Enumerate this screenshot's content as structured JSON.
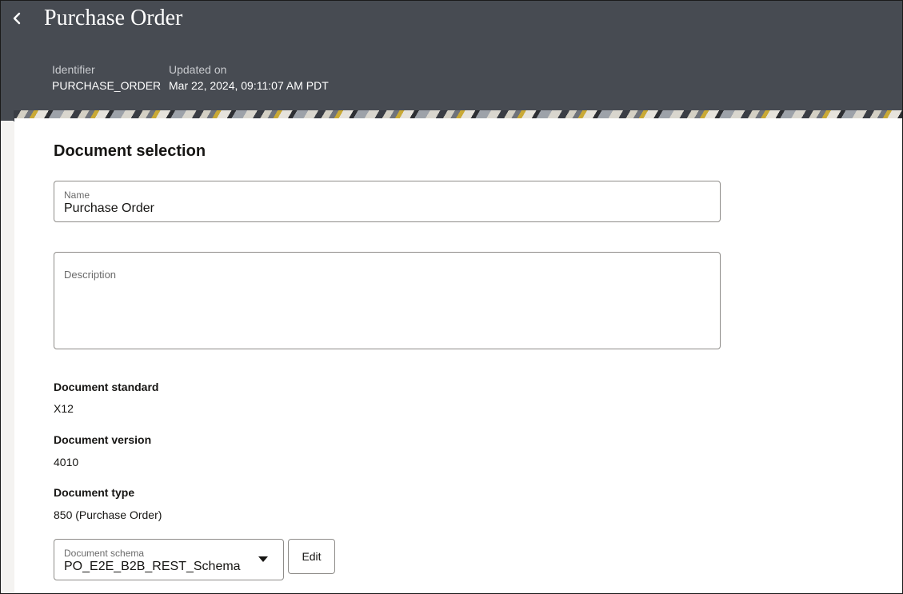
{
  "header": {
    "title": "Purchase Order",
    "identifier_label": "Identifier",
    "identifier_value": "PURCHASE_ORDER",
    "updated_label": "Updated on",
    "updated_value": "Mar 22, 2024, 09:11:07 AM PDT",
    "back_icon": "chevron-left-icon",
    "background_color": "#474b52"
  },
  "section": {
    "title": "Document selection"
  },
  "form": {
    "name_label": "Name",
    "name_value": "Purchase Order",
    "description_label": "Description",
    "description_value": ""
  },
  "details": {
    "standard_label": "Document standard",
    "standard_value": "X12",
    "version_label": "Document version",
    "version_value": "4010",
    "type_label": "Document type",
    "type_value": "850 (Purchase Order)"
  },
  "schema": {
    "label": "Document schema",
    "value": "PO_E2E_B2B_REST_Schema",
    "dropdown_icon": "caret-down-icon",
    "edit_label": "Edit"
  }
}
